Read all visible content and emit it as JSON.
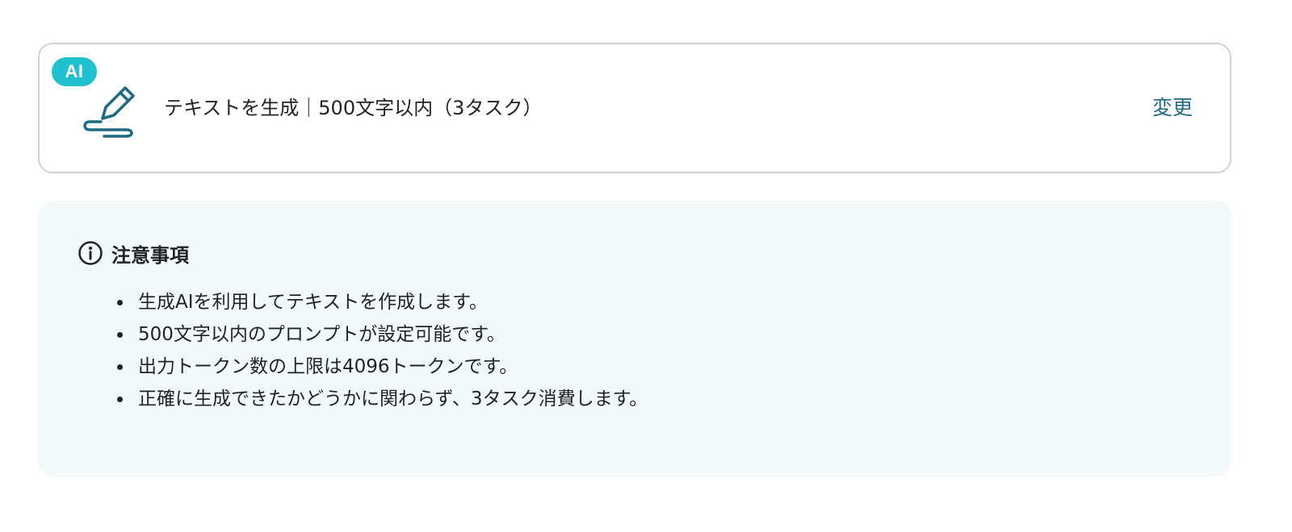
{
  "action": {
    "badge": "AI",
    "icon": "pen-icon",
    "title": "テキストを生成｜500文字以内（3タスク）",
    "change_label": "変更"
  },
  "notice": {
    "icon": "info-icon",
    "title": "注意事項",
    "items": [
      "生成AIを利用してテキストを作成します。",
      "500文字以内のプロンプトが設定可能です。",
      "出力トークン数の上限は4096トークンです。",
      "正確に生成できたかどうかに関わらず、3タスク消費します。"
    ]
  },
  "colors": {
    "badge": "#21c0cf",
    "accent": "#1e6a82",
    "panel_background": "#f3f8f8",
    "card_border": "#cfd3d6"
  }
}
